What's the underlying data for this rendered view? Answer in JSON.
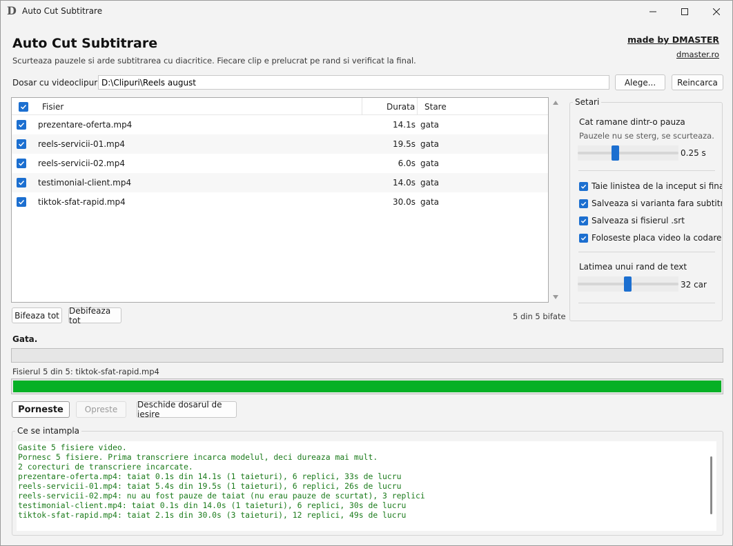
{
  "window": {
    "title": "Auto Cut Subtitrare",
    "app_icon": "D"
  },
  "header": {
    "title": "Auto Cut Subtitrare",
    "subtitle": "Scurteaza pauzele si arde subtitrarea cu diacritice. Fiecare clip e prelucrat pe rand si verificat la final.",
    "made_by": "made by DMASTER",
    "site": "dmaster.ro"
  },
  "folder": {
    "label": "Dosar cu videoclipuri:",
    "value": "D:\\Clipuri\\Reels august",
    "browse_label": "Alege...",
    "reload_label": "Reincarca"
  },
  "filelist": {
    "columns": {
      "file": "Fisier",
      "duration": "Durata",
      "state": "Stare"
    },
    "rows": [
      {
        "name": "prezentare-oferta.mp4",
        "duration": "14.1s",
        "state": "gata",
        "checked": true
      },
      {
        "name": "reels-servicii-01.mp4",
        "duration": "19.5s",
        "state": "gata",
        "checked": true
      },
      {
        "name": "reels-servicii-02.mp4",
        "duration": "6.0s",
        "state": "gata",
        "checked": true
      },
      {
        "name": "testimonial-client.mp4",
        "duration": "14.0s",
        "state": "gata",
        "checked": true
      },
      {
        "name": "tiktok-sfat-rapid.mp4",
        "duration": "30.0s",
        "state": "gata",
        "checked": true
      }
    ],
    "select_all_label": "Bifeaza tot",
    "deselect_all_label": "Debifeaza tot",
    "count_label": "5 din 5 bifate"
  },
  "settings": {
    "title": "Setari",
    "pause_label": "Cat ramane dintr-o pauza",
    "pause_note": "Pauzele nu se sterg, se scurteaza.",
    "pause_value": "0.25 s",
    "options": [
      {
        "label": "Taie linistea de la inceput si final",
        "checked": true
      },
      {
        "label": "Salveaza si varianta fara subtitrare",
        "checked": true
      },
      {
        "label": "Salveaza si fisierul .srt",
        "checked": true
      },
      {
        "label": "Foloseste placa video la codare",
        "checked": true
      }
    ],
    "line_width_label": "Latimea unui rand de text",
    "line_width_value": "32 car",
    "accent_color": "#1c6fd0"
  },
  "progress": {
    "status": "Gata.",
    "file_info": "Fisierul 5 din 5: tiktok-sfat-rapid.mp4",
    "file_progress": 1.0,
    "bar_color": "#06b025"
  },
  "actions": {
    "start_label": "Porneste",
    "stop_label": "Opreste",
    "open_output_label": "Deschide dosarul de iesire"
  },
  "log": {
    "title": "Ce se intampla",
    "lines": [
      "Gasite 5 fisiere video.",
      "Pornesc 5 fisiere. Prima transcriere incarca modelul, deci dureaza mai mult.",
      "2 corecturi de transcriere incarcate.",
      "prezentare-oferta.mp4: taiat 0.1s din 14.1s (1 taieturi), 6 replici, 33s de lucru",
      "reels-servicii-01.mp4: taiat 5.4s din 19.5s (1 taieturi), 6 replici, 26s de lucru",
      "reels-servicii-02.mp4: nu au fost pauze de taiat (nu erau pauze de scurtat), 3 replici",
      "testimonial-client.mp4: taiat 0.1s din 14.0s (1 taieturi), 6 replici, 30s de lucru",
      "tiktok-sfat-rapid.mp4: taiat 2.1s din 30.0s (3 taieturi), 12 replici, 49s de lucru"
    ]
  }
}
